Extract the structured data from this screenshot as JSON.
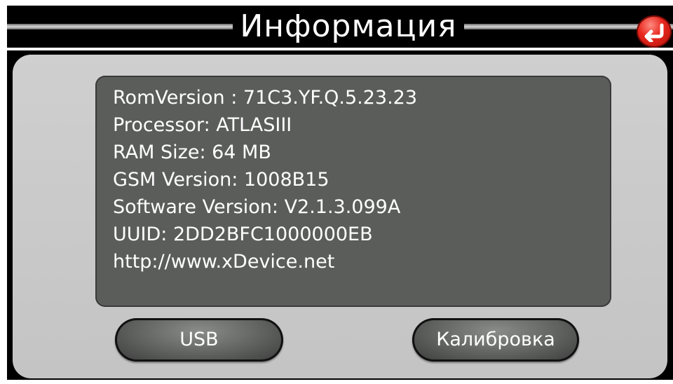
{
  "header": {
    "title": "Информация",
    "back_icon": "back-arrow-icon",
    "back_color": "#e8281e"
  },
  "info": {
    "lines": [
      "RomVersion : 71C3.YF.Q.5.23.23",
      "Processor: ATLASIII",
      "RAM Size: 64 MB",
      "GSM Version: 1008B15",
      "Software Version: V2.1.3.099A",
      "UUID: 2DD2BFC1000000EB",
      "http://www.xDevice.net"
    ]
  },
  "buttons": {
    "usb_label": "USB",
    "calibration_label": "Калибровка"
  }
}
